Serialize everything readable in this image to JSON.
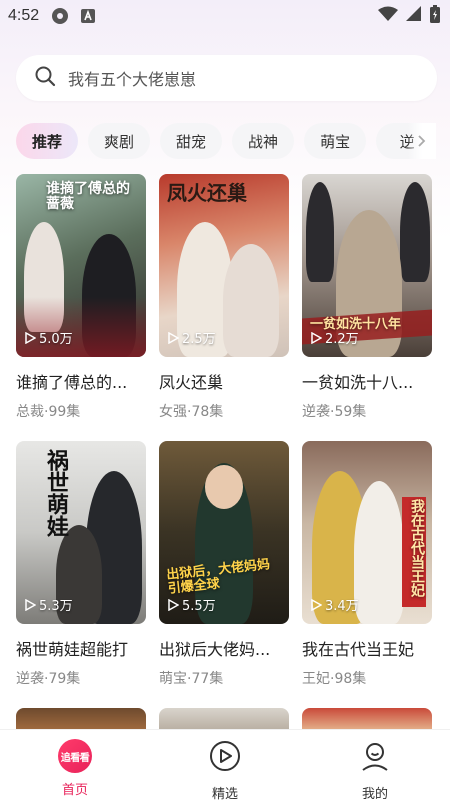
{
  "status": {
    "time": "4:52"
  },
  "search": {
    "placeholder": "我有五个大佬崽崽"
  },
  "tabs": [
    {
      "label": "推荐",
      "active": true
    },
    {
      "label": "爽剧"
    },
    {
      "label": "甜宠"
    },
    {
      "label": "战神"
    },
    {
      "label": "萌宝"
    },
    {
      "label": "逆"
    }
  ],
  "dramas": [
    {
      "title": "谁摘了傅总的...",
      "genre": "总裁",
      "episodes": "99集",
      "meta": "总裁·99集",
      "views": "5.0万",
      "poster_text": "谁摘了傅总的蔷薇"
    },
    {
      "title": "凤火还巢",
      "genre": "女强",
      "episodes": "78集",
      "meta": "女强·78集",
      "views": "2.5万",
      "poster_text": "凤火还巢"
    },
    {
      "title": "一贫如洗十八...",
      "genre": "逆袭",
      "episodes": "59集",
      "meta": "逆袭·59集",
      "views": "2.2万",
      "poster_text": "一贫如洗十八年"
    },
    {
      "title": "祸世萌娃超能打",
      "genre": "逆袭",
      "episodes": "79集",
      "meta": "逆袭·79集",
      "views": "5.3万",
      "poster_text": "祸世萌娃"
    },
    {
      "title": "出狱后大佬妈...",
      "genre": "萌宝",
      "episodes": "77集",
      "meta": "萌宝·77集",
      "views": "5.5万",
      "poster_text": "出狱后，大佬妈妈 引爆全球"
    },
    {
      "title": "我在古代当王妃",
      "genre": "王妃",
      "episodes": "98集",
      "meta": "王妃·98集",
      "views": "3.4万",
      "poster_text": "我在古代当王妃"
    }
  ],
  "nav": {
    "home_logo": "追看看",
    "home": "首页",
    "featured": "精选",
    "mine": "我的"
  },
  "colors": {
    "accent": "#e8235a",
    "tab_active": "#fbd7ea"
  },
  "icons": [
    "gear-icon",
    "a-icon",
    "wifi-icon",
    "battery-icon",
    "search-icon",
    "chevron-right-icon",
    "play-icon",
    "play-circle-icon",
    "user-icon"
  ]
}
